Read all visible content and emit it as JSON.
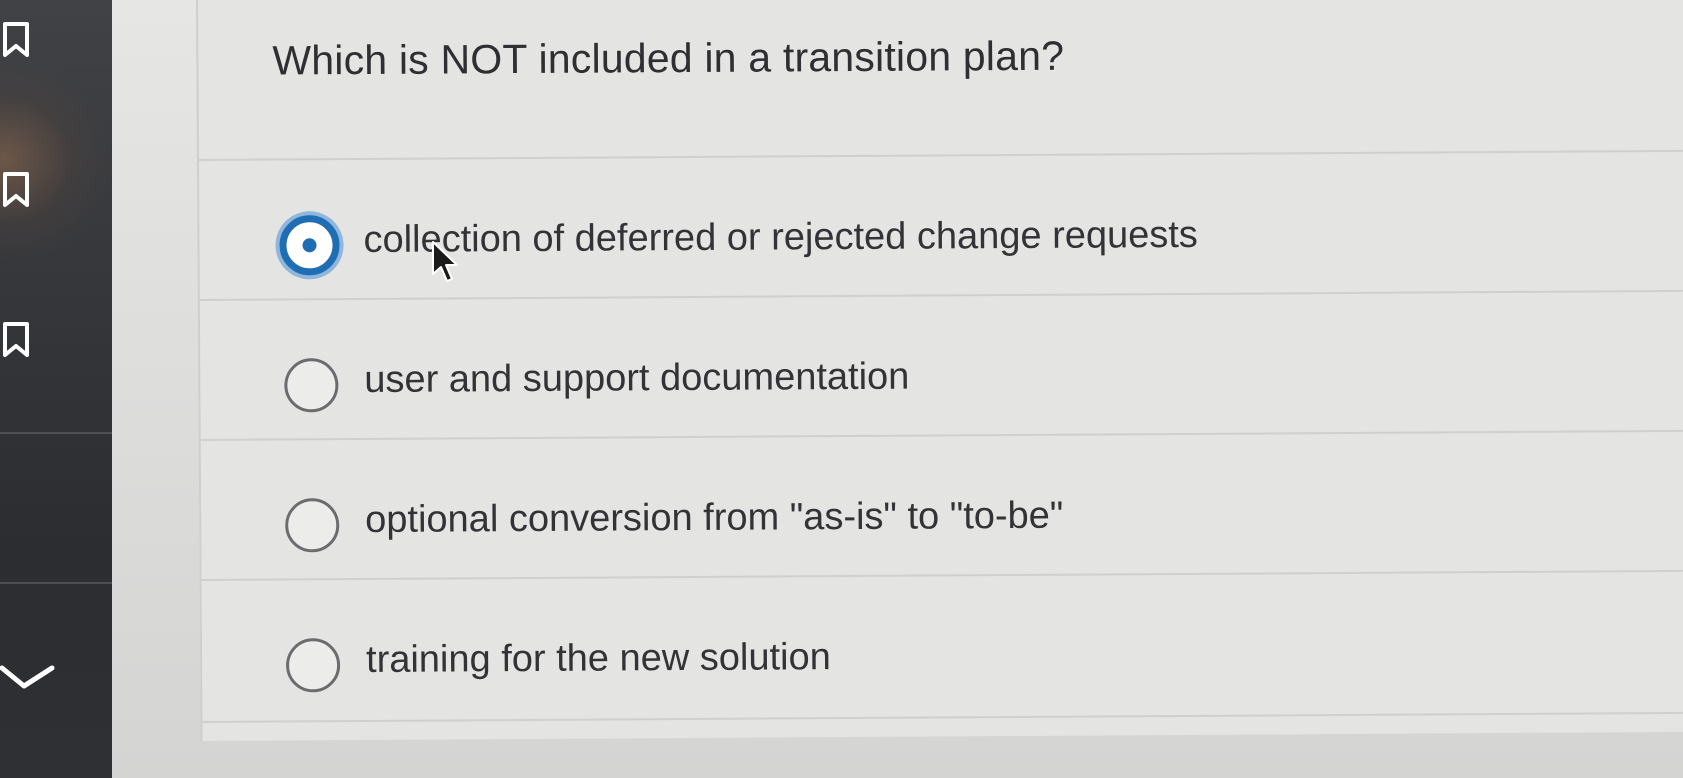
{
  "sidebar": {
    "icons": [
      "bookmark-icon",
      "bookmark-icon",
      "bookmark-icon",
      "chevron-down-icon"
    ]
  },
  "question": {
    "text": "Which is NOT included in a transition plan?"
  },
  "options": [
    {
      "label": "collection of deferred or rejected change requests",
      "selected": true
    },
    {
      "label": "user and support documentation",
      "selected": false
    },
    {
      "label": "optional conversion from \"as-is\" to \"to-be\"",
      "selected": false
    },
    {
      "label": "training for the new solution",
      "selected": false
    }
  ],
  "colors": {
    "accent": "#1f6db2",
    "text": "#333337",
    "sidebar": "#34363a"
  }
}
